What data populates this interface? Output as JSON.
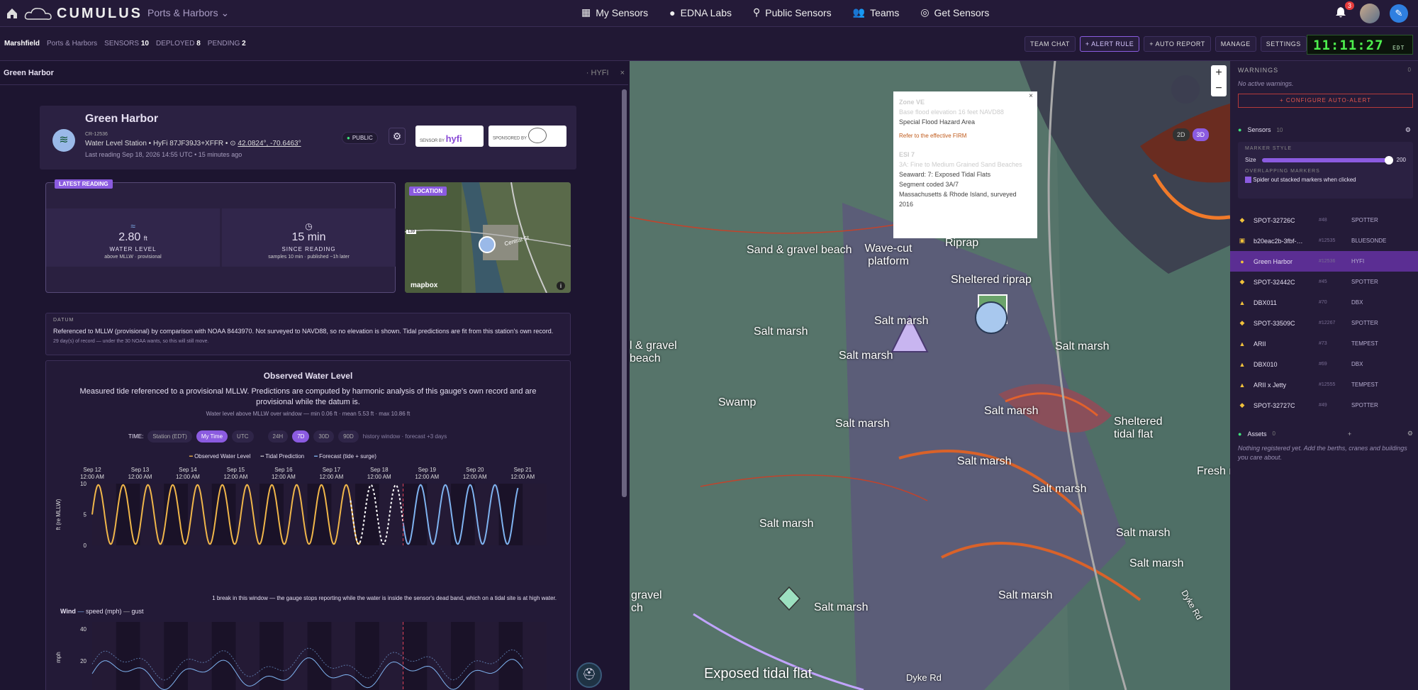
{
  "app": {
    "logo": "CUMULUS",
    "workspace": "Ports & Harbors",
    "notifications": "3"
  },
  "nav": [
    "My Sensors",
    "EDNA Labs",
    "Public Sensors",
    "Teams",
    "Get Sensors"
  ],
  "sub": {
    "site": "Marshfield",
    "org": "Ports & Harbors",
    "sensors_lbl": "SENSORS",
    "sensors": "10",
    "deployed_lbl": "DEPLOYED",
    "deployed": "8",
    "pending_lbl": "PENDING",
    "pending": "2"
  },
  "actions": [
    "TEAM CHAT",
    "+ ALERT RULE",
    "+ AUTO REPORT",
    "MANAGE",
    "SETTINGS"
  ],
  "clock": {
    "time": "11:11:27",
    "tz": "EDT"
  },
  "panel": {
    "title": "Green Harbor",
    "tag": "· HYFI",
    "close": "×"
  },
  "station": {
    "name": "Green Harbor",
    "id": "CR-12536",
    "desc": "Water Level Station • HyFi 87JF39J3+XFFR • ",
    "coords": "42.0824°, -70.6463°",
    "last": "Last reading Sep 18, 2026 14:55 UTC • 15 minutes ago",
    "public": "PUBLIC",
    "sensor_by": "SENSOR BY",
    "sponsored_by": "SPONSORED BY"
  },
  "latest": {
    "tag": "LATEST READING",
    "value": "2.80",
    "unit": "ft",
    "label": "WATER LEVEL",
    "sub": "above MLLW · provisional",
    "since_value": "15 min",
    "since_label": "SINCE READING",
    "since_sub": "samples 10 min · published ~1h later"
  },
  "location": {
    "tag": "LOCATION",
    "mapbox": "mapbox",
    "road": "139",
    "street": "Central St"
  },
  "datum": {
    "head": "DATUM",
    "text": "Referenced to MLLW (provisional) by comparison with NOAA 8443970. Not surveyed to NAVD88, so no elevation is shown. Tidal predictions are fit from this station's own record.",
    "sub": "29 day(s) of record — under the 30 NOAA wants, so this will still move."
  },
  "owl": {
    "title": "Observed Water Level",
    "desc": "Measured tide referenced to a provisional MLLW. Predictions are computed by harmonic analysis of this gauge's own record and are provisional while the datum is.",
    "stats": "Water level above MLLW over window — min 0.06 ft · mean 5.53 ft · max 10.86 ft",
    "time_lbl": "TIME:",
    "time_opts": [
      "Station (EDT)",
      "My Time",
      "UTC"
    ],
    "windows": [
      "24H",
      "7D",
      "30D",
      "90D"
    ],
    "hist": "history window · forecast +3 days",
    "legend": [
      "Observed Water Level",
      "Tidal Prediction",
      "Forecast (tide + surge)"
    ],
    "ylabel": "ft (re MLLW)",
    "note": "1 break in this window — the gauge stops reporting while the water is inside the sensor's dead band, which on a tidal site is at high water.",
    "wind": "Wind",
    "wind_legend": [
      "speed (mph)",
      "gust"
    ],
    "wind_ylabel": "mph"
  },
  "chart_data": {
    "type": "line",
    "x": [
      "Sep 12 12:00 AM",
      "Sep 13 12:00 AM",
      "Sep 14 12:00 AM",
      "Sep 15 12:00 AM",
      "Sep 16 12:00 AM",
      "Sep 17 12:00 AM",
      "Sep 18 12:00 AM",
      "Sep 19 12:00 AM",
      "Sep 20 12:00 AM",
      "Sep 21 12:00 AM"
    ],
    "ylim": [
      0,
      10
    ],
    "yticks": [
      0,
      5,
      10
    ],
    "series": [
      {
        "name": "Observed Water Level",
        "color": "#f0b64a",
        "start_day": 0,
        "end_day": 5.6
      },
      {
        "name": "Tidal Prediction",
        "color": "#ffffff",
        "start_day": 5.4,
        "end_day": 6.5
      },
      {
        "name": "Forecast (tide + surge)",
        "color": "#7fb3f0",
        "start_day": 6.5,
        "end_day": 8.9
      }
    ],
    "wind_yticks": [
      20,
      40
    ]
  },
  "popup": {
    "zone": "Zone VE",
    "bfe": "Base flood elevation 16 feet NAVD88",
    "sfha": "Special Flood Hazard Area",
    "firm": "Refer to the effective FIRM",
    "esi": "ESI 7",
    "esi_sub": "3A: Fine to Medium Grained Sand Beaches",
    "sea": "Seaward: 7: Exposed Tidal Flats",
    "seg": "Segment coded 3A/7",
    "survey": "Massachusetts & Rhode Island, surveyed 2016",
    "close": "×"
  },
  "map_labels": [
    "Sand & gravel beach",
    "Wave-cut platform",
    "Riprap",
    "Sheltered riprap",
    "Salt marsh",
    "Salt marsh",
    "Salt marsh",
    "Salt marsh",
    "Salt marsh",
    "Salt marsh",
    "Salt marsh",
    "Salt marsh",
    "Salt marsh",
    "Salt marsh",
    "Salt marsh",
    "Salt marsh",
    "Salt marsh",
    "Sheltered tidal flat",
    "Swamp",
    "Exposed tidal flat",
    "Dyke Rd",
    "Dyke Rd",
    "gravel ch",
    "l & gravel beach",
    "Fresh ma"
  ],
  "map_ctrls": {
    "plus": "+",
    "minus": "−",
    "d2": "2D",
    "d3": "3D"
  },
  "right": {
    "warnings": "WARNINGS",
    "warn_count": "0",
    "no_warn": "No active warnings.",
    "auto_alert": "+ CONFIGURE AUTO-ALERT",
    "sensors": "Sensors",
    "sensors_count": "10",
    "marker_style": "MARKER STYLE",
    "size": "Size",
    "size_val": "200",
    "overlap": "OVERLAPPING MARKERS",
    "spider": "Spider out stacked markers when clicked",
    "assets": "Assets",
    "assets_count": "0",
    "assets_empty": "Nothing registered yet. Add the berths, cranes and buildings you care about."
  },
  "sensor_list": [
    {
      "name": "SPOT-32726C",
      "id": "#48",
      "type": "SPOTTER",
      "icon": "◆"
    },
    {
      "name": "b20eac2b-3fbf-…",
      "id": "#12535",
      "type": "BLUESONDE",
      "icon": "▣"
    },
    {
      "name": "Green Harbor",
      "id": "#12536",
      "type": "HYFI",
      "icon": "●"
    },
    {
      "name": "SPOT-32442C",
      "id": "#45",
      "type": "SPOTTER",
      "icon": "◆"
    },
    {
      "name": "DBX011",
      "id": "#70",
      "type": "DBX",
      "icon": "▲"
    },
    {
      "name": "SPOT-33509C",
      "id": "#12267",
      "type": "SPOTTER",
      "icon": "◆"
    },
    {
      "name": "ARII",
      "id": "#73",
      "type": "TEMPEST",
      "icon": "▲"
    },
    {
      "name": "DBX010",
      "id": "#69",
      "type": "DBX",
      "icon": "▲"
    },
    {
      "name": "ARII x Jetty",
      "id": "#12555",
      "type": "TEMPEST",
      "icon": "▲"
    },
    {
      "name": "SPOT-32727C",
      "id": "#49",
      "type": "SPOTTER",
      "icon": "◆"
    }
  ]
}
